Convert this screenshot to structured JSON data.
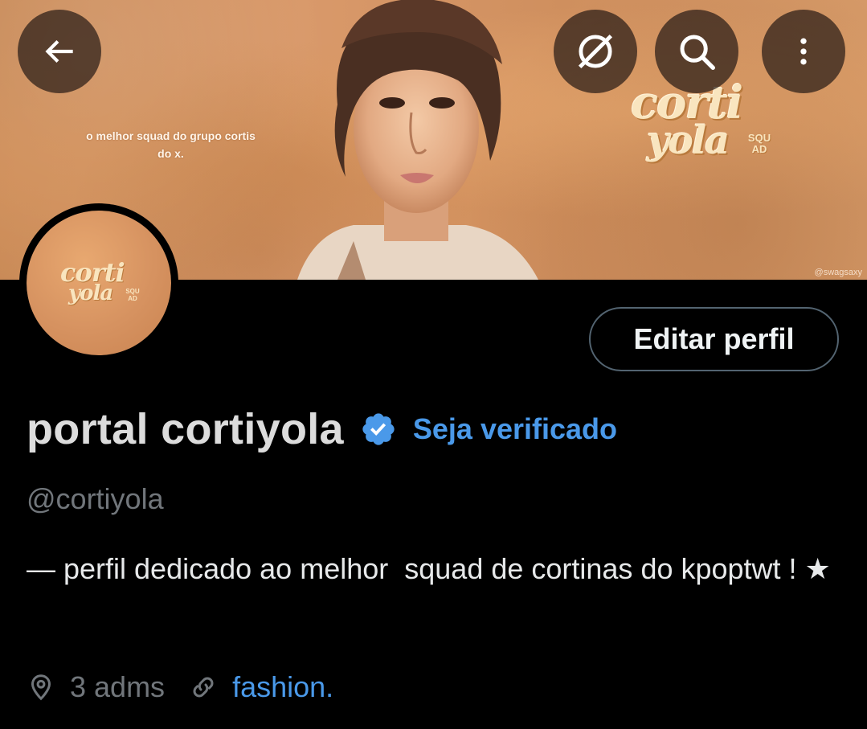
{
  "header": {
    "banner_caption": "o melhor squad do grupo cortis do x.",
    "banner_logo_line1": "corti",
    "banner_logo_line2": "yola",
    "banner_logo_squad": "SQU AD",
    "watermark": "@swagsaxy",
    "buttons": {
      "back_icon": "arrow-left-icon",
      "grok_icon": "grok-icon",
      "search_icon": "search-icon",
      "more_icon": "more-vertical-icon"
    }
  },
  "profile": {
    "avatar_logo_line1": "corti",
    "avatar_logo_line2": "yola",
    "avatar_logo_squad": "SQU AD",
    "edit_button_label": "Editar perfil",
    "display_name": "portal cortiyola",
    "get_verified_label": "Seja verificado",
    "handle": "@cortiyola",
    "bio": "— perfil dedicado ao melhor  squad de cortinas do kpoptwt ! ★",
    "location": "3 adms",
    "website": "fashion.",
    "colors": {
      "accent": "#4a99e9",
      "muted": "#71767b",
      "background": "#000000"
    }
  }
}
